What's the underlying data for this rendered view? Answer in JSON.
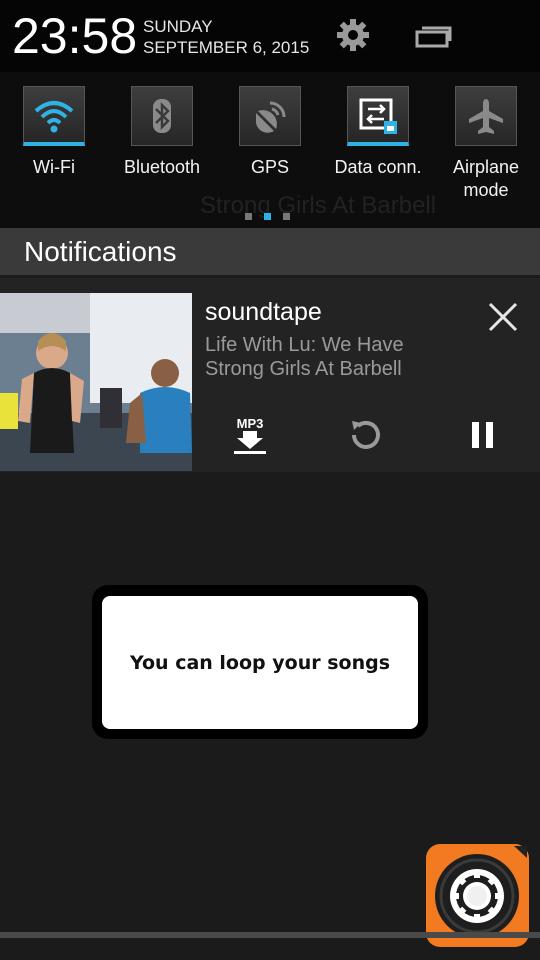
{
  "status": {
    "time": "23:58",
    "day": "SUNDAY",
    "date": "SEPTEMBER 6, 2015"
  },
  "quick_settings": {
    "background_ghost_text": "Strong Girls At Barbell",
    "tiles": [
      {
        "label": "Wi-Fi",
        "icon": "wifi-icon",
        "active": true
      },
      {
        "label": "Bluetooth",
        "icon": "bluetooth-icon",
        "active": false
      },
      {
        "label": "GPS",
        "icon": "gps-icon",
        "active": false
      },
      {
        "label": "Data conn.",
        "icon": "data-connection-icon",
        "active": true
      },
      {
        "label": "Airplane\nmode",
        "icon": "airplane-icon",
        "active": false
      }
    ],
    "page_indicator": {
      "pages": 3,
      "active": 1
    }
  },
  "notifications": {
    "header": "Notifications",
    "music": {
      "app_name": "soundtape",
      "track_title": "Life With Lu: We Have Strong Girls At Barbell",
      "mp3_label": "MP3"
    }
  },
  "tooltip": {
    "text": "You can loop your songs"
  },
  "colors": {
    "accent": "#2fb2e5",
    "fab": "#f27a21"
  }
}
